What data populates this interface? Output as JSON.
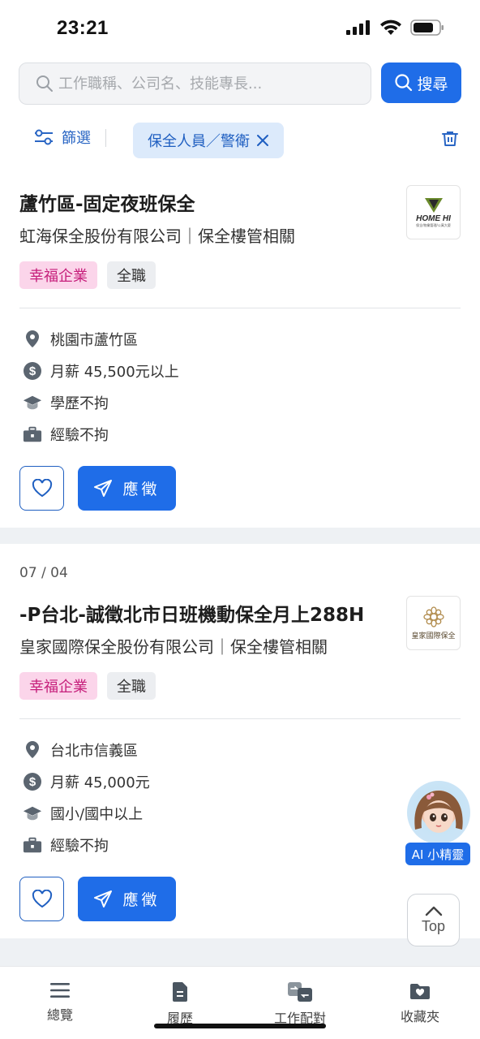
{
  "status_bar": {
    "time": "23:21"
  },
  "search": {
    "placeholder": "工作職稱、公司名、技能專長...",
    "button_label": "搜尋"
  },
  "filter": {
    "label": "篩選",
    "chip_label": "保全人員／警衛"
  },
  "jobs": [
    {
      "date": "",
      "title": "蘆竹區-固定夜班保全",
      "company": "虹海保全股份有限公司｜保全樓管相關",
      "logo_text": "HOME HI",
      "logo_subtext": "保全/物業管理/公寓大廈",
      "tags": [
        "幸福企業",
        "全職"
      ],
      "location": "桃園市蘆竹區",
      "salary": "月薪 45,500元以上",
      "education": "學歷不拘",
      "experience": "經驗不拘",
      "apply_label": "應徵"
    },
    {
      "date": "07 / 04",
      "title": "-P台北-誠徵北市日班機動保全月上288H",
      "company": "皇家國際保全股份有限公司｜保全樓管相關",
      "logo_text": "皇家國際保全",
      "tags": [
        "幸福企業",
        "全職"
      ],
      "location": "台北市信義區",
      "salary": "月薪 45,000元",
      "education": "國小/國中以上",
      "experience": "經驗不拘",
      "apply_label": "應徵"
    }
  ],
  "ai_helper": {
    "label": "AI 小精靈"
  },
  "top_button": {
    "label": "Top"
  },
  "tabbar": {
    "items": [
      {
        "label": "總覽",
        "icon": "menu-icon"
      },
      {
        "label": "履歷",
        "icon": "resume-icon"
      },
      {
        "label": "工作配對",
        "icon": "match-icon"
      },
      {
        "label": "收藏夾",
        "icon": "folder-heart-icon"
      }
    ]
  },
  "colors": {
    "primary": "#1f6de8",
    "tag_pink_bg": "#fbd5ea",
    "tag_pink_text": "#c61f7b"
  }
}
